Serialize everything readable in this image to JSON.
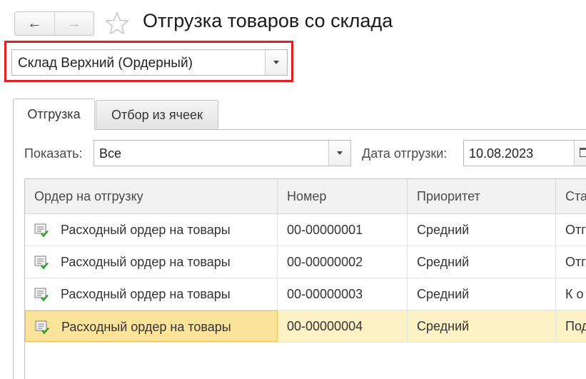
{
  "header": {
    "back_icon": "arrow-left-icon",
    "forward_icon": "arrow-right-icon",
    "favorite_icon": "star-icon",
    "title": "Отгрузка товаров со склада"
  },
  "warehouse": {
    "value": "Склад Верхний (Ордерный)",
    "highlight_color": "#e02020"
  },
  "tabs": [
    {
      "label": "Отгрузка",
      "active": true
    },
    {
      "label": "Отбор из ячеек",
      "active": false
    }
  ],
  "filters": {
    "show_label": "Показать:",
    "show_value": "Все",
    "date_label": "Дата отгрузки:",
    "date_value": "10.08.2023"
  },
  "table": {
    "columns": [
      "Ордер на отгрузку",
      "Номер",
      "Приоритет",
      "Ста"
    ],
    "rows": [
      {
        "order": "Расходный ордер на товары",
        "number": "00-00000001",
        "priority": "Средний",
        "status": "Отг"
      },
      {
        "order": "Расходный ордер на товары",
        "number": "00-00000002",
        "priority": "Средний",
        "status": "Отг"
      },
      {
        "order": "Расходный ордер на товары",
        "number": "00-00000003",
        "priority": "Средний",
        "status": "К о"
      },
      {
        "order": "Расходный ордер на товары",
        "number": "00-00000004",
        "priority": "Средний",
        "status": "Под"
      }
    ],
    "selected_row_index": 3
  },
  "colors": {
    "selected_row": "#fdf1c6",
    "selected_cell": "#fbe39a",
    "header_bg": "#f2f2f2"
  }
}
